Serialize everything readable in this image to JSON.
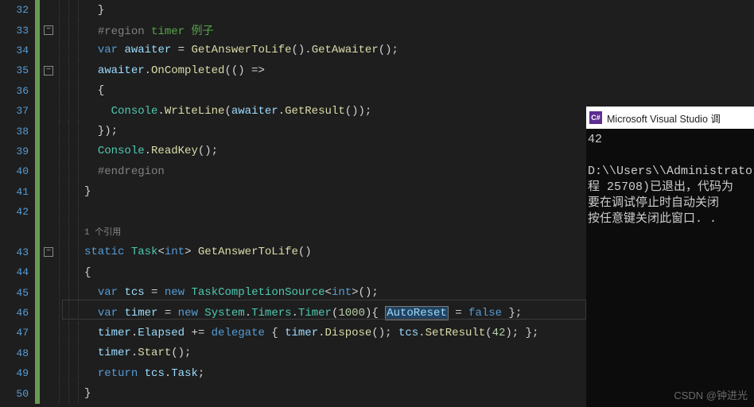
{
  "editor": {
    "lines": [
      {
        "n": "32",
        "fold": "",
        "html": "  }"
      },
      {
        "n": "33",
        "fold": "-",
        "html": "  <span class='tk-comment-key'>#region</span> <span class='tk-comment'>timer 例子</span>"
      },
      {
        "n": "34",
        "fold": "",
        "html": "  <span class='tk-keyword'>var</span> <span class='tk-var'>awaiter</span> = <span class='tk-method'>GetAnswerToLife</span>().<span class='tk-method'>GetAwaiter</span>();"
      },
      {
        "n": "35",
        "fold": "-",
        "html": "  <span class='tk-var'>awaiter</span>.<span class='tk-method'>OnCompleted</span>(() =>"
      },
      {
        "n": "36",
        "fold": "",
        "html": "  {"
      },
      {
        "n": "37",
        "fold": "",
        "html": "    <span class='tk-type'>Console</span>.<span class='tk-method'>WriteLine</span>(<span class='tk-var'>awaiter</span>.<span class='tk-method'>GetResult</span>());"
      },
      {
        "n": "38",
        "fold": "",
        "html": "  });"
      },
      {
        "n": "39",
        "fold": "",
        "html": "  <span class='tk-type'>Console</span>.<span class='tk-method'>ReadKey</span>();"
      },
      {
        "n": "40",
        "fold": "",
        "html": "  <span class='tk-comment-key'>#endregion</span>"
      },
      {
        "n": "41",
        "fold": "",
        "html": "}"
      },
      {
        "n": "42",
        "fold": "",
        "html": ""
      },
      {
        "n": "",
        "fold": "",
        "codelens": "1 个引用"
      },
      {
        "n": "43",
        "fold": "-",
        "html": "<span class='tk-keyword'>static</span> <span class='tk-type'>Task</span>&lt;<span class='tk-keyword'>int</span>&gt; <span class='tk-method'>GetAnswerToLife</span>()"
      },
      {
        "n": "44",
        "fold": "",
        "html": "{"
      },
      {
        "n": "45",
        "fold": "",
        "html": "  <span class='tk-keyword'>var</span> <span class='tk-var'>tcs</span> = <span class='tk-keyword'>new</span> <span class='tk-type'>TaskCompletionSource</span>&lt;<span class='tk-keyword'>int</span>&gt;();"
      },
      {
        "n": "46",
        "fold": "",
        "highlight": true,
        "html": "  <span class='tk-keyword'>var</span> <span class='tk-var'>timer</span> = <span class='tk-keyword'>new</span> <span class='tk-type'>System</span>.<span class='tk-type'>Timers</span>.<span class='tk-type'>Timer</span>(<span class='tk-num'>1000</span>){ <span class='sel'><span class='tk-var'>AutoReset</span></span> = <span class='tk-keyword'>false</span> };"
      },
      {
        "n": "47",
        "fold": "",
        "html": "  <span class='tk-var'>timer</span>.<span class='tk-var'>Elapsed</span> += <span class='tk-keyword'>delegate</span> { <span class='tk-var'>timer</span>.<span class='tk-method'>Dispose</span>(); <span class='tk-var'>tcs</span>.<span class='tk-method'>SetResult</span>(<span class='tk-num'>42</span>); };"
      },
      {
        "n": "48",
        "fold": "",
        "html": "  <span class='tk-var'>timer</span>.<span class='tk-method'>Start</span>();"
      },
      {
        "n": "49",
        "fold": "",
        "html": "  <span class='tk-keyword'>return</span> <span class='tk-var'>tcs</span>.<span class='tk-var'>Task</span>;"
      },
      {
        "n": "50",
        "fold": "",
        "html": "}"
      }
    ]
  },
  "console": {
    "title": "Microsoft Visual Studio 调",
    "icon_text": "C#",
    "body_lines": [
      "42",
      "",
      "D:\\\\Users\\\\Administrator",
      "程 25708)已退出，代码为",
      "要在调试停止时自动关闭",
      "按任意键关闭此窗口. ."
    ]
  },
  "watermark": "CSDN @钟进光"
}
